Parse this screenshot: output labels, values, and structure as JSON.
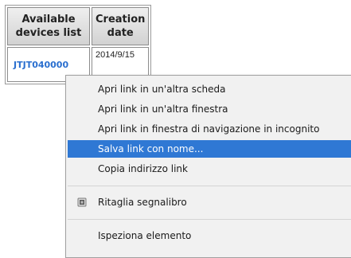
{
  "table": {
    "header_devices": "Available devices list",
    "header_date": "Creation date",
    "device_id": "JTJT040000",
    "creation_date": "2014/9/15"
  },
  "context_menu": {
    "items": [
      {
        "label": "Apri link in un'altra scheda"
      },
      {
        "label": "Apri link in un'altra finestra"
      },
      {
        "label": "Apri link in finestra di navigazione in incognito"
      },
      {
        "label": "Salva link con nome...",
        "highlighted": true
      },
      {
        "label": "Copia indirizzo link"
      },
      {
        "label": "Ritaglia segnalibro",
        "icon": "bookmark-clip-icon"
      },
      {
        "label": "Ispeziona elemento"
      }
    ],
    "highlight_color": "#2f78d4"
  }
}
